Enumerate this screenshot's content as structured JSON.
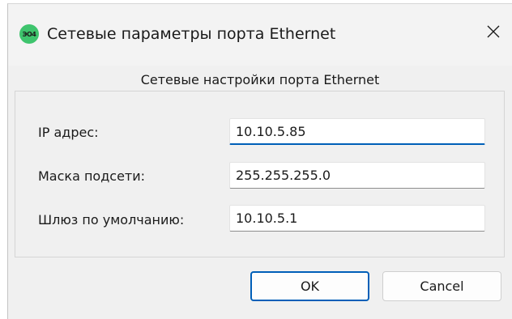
{
  "window": {
    "title": "Сетевые параметры порта Ethernet",
    "app_icon_text": "ЭО4"
  },
  "group": {
    "title": "Сетевые настройки порта Ethernet"
  },
  "fields": [
    {
      "label": "IP адрес:",
      "value": "10.10.5.85"
    },
    {
      "label": "Маска подсети:",
      "value": "255.255.255.0"
    },
    {
      "label": "Шлюз по умолчанию:",
      "value": "10.10.5.1"
    }
  ],
  "buttons": {
    "ok_label": "OK",
    "cancel_label": "Cancel"
  },
  "colors": {
    "accent": "#005fb8",
    "app_icon": "#3ec46d"
  },
  "icons": {
    "app": "app-logo-icon",
    "close": "close-icon"
  }
}
